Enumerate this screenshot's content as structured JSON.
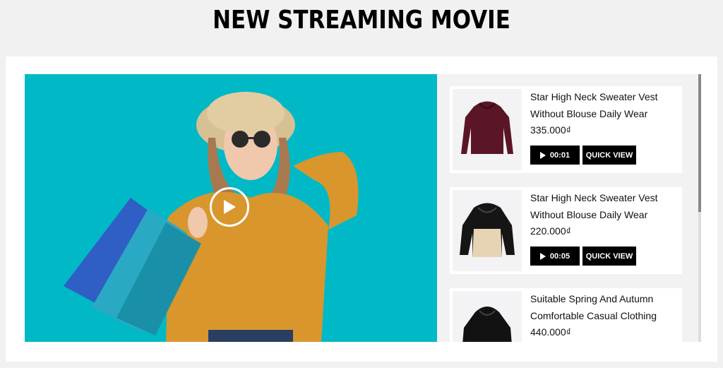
{
  "page": {
    "title": "NEW STREAMING MOVIE"
  },
  "video": {
    "play_icon": "play-icon"
  },
  "products": [
    {
      "name": "Star High Neck Sweater Vest Without Blouse Daily Wear",
      "price": "335.000₫",
      "duration": "00:01",
      "quick_view": "QUICK VIEW",
      "image": "maroon-hooded-jacket"
    },
    {
      "name": "Star High Neck Sweater Vest Without Blouse Daily Wear",
      "price": "220.000₫",
      "duration": "00:05",
      "quick_view": "QUICK VIEW",
      "image": "black-beige-jacket"
    },
    {
      "name": "Suitable Spring And Autumn Comfortable Casual Clothing",
      "price": "440.000₫",
      "image": "black-hooded-jacket"
    }
  ]
}
